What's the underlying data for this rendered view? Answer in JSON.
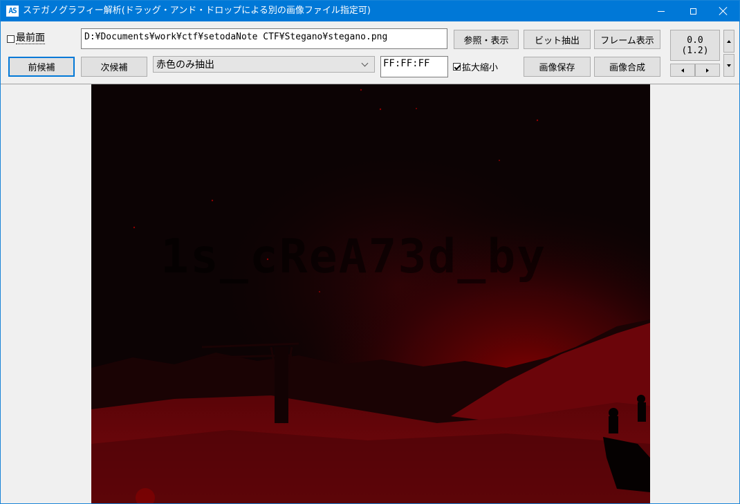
{
  "window": {
    "app_icon": "AS",
    "title": "ステガノグラフィー解析(ドラッグ・アンド・ドロップによる別の画像ファイル指定可)"
  },
  "toolbar": {
    "topmost_label": "最前面",
    "topmost_checked": false,
    "path_value": "D:¥Documents¥work¥ctf¥setodaNote CTF¥Stegano¥stegano.png",
    "browse_label": "参照・表示",
    "bit_extract_label": "ビット抽出",
    "frame_view_label": "フレーム表示",
    "prev_label": "前候補",
    "next_label": "次候補",
    "mode_select_value": "赤色のみ抽出",
    "color_value": "FF:FF:FF",
    "zoom_label": "拡大縮小",
    "zoom_checked": true,
    "save_image_label": "画像保存",
    "compose_image_label": "画像合成",
    "value_line1": "0.0",
    "value_line2": "(1.2)"
  },
  "image": {
    "hidden_text": "1s_cReA73d_by",
    "tint_color": "#8b0000"
  }
}
